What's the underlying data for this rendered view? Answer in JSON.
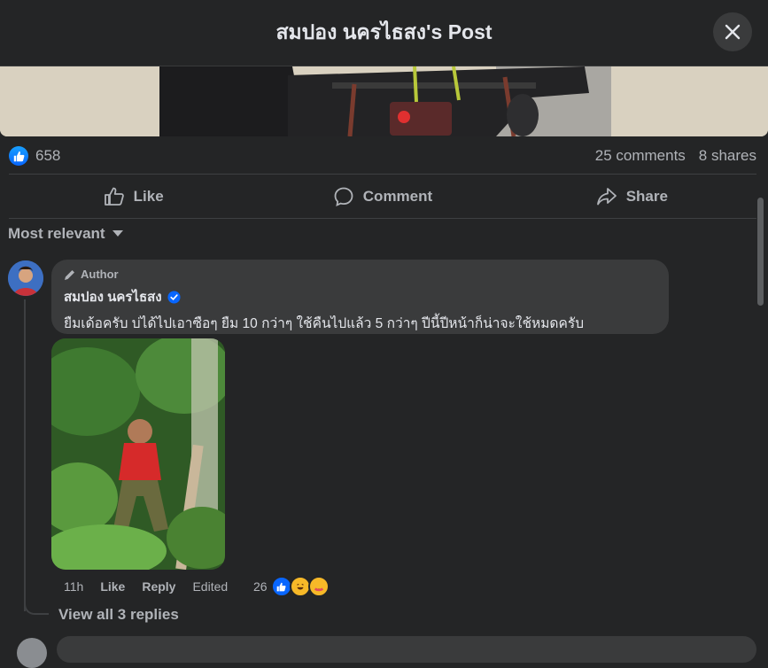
{
  "header": {
    "title": "สมปอง นครไธสง's Post",
    "close_icon": "close-icon"
  },
  "post": {
    "photo_icon": "motorbike-photo",
    "reaction_icon": "like-icon",
    "like_count": "658",
    "comments": "25 comments",
    "shares": "8 shares"
  },
  "actions": {
    "like": "Like",
    "comment": "Comment",
    "share": "Share"
  },
  "sort": {
    "label": "Most relevant"
  },
  "comment": {
    "author_badge": "Author",
    "name": "สมปอง นครไธสง",
    "verified_icon": "verified-badge-icon",
    "text": "ยืมเด้อครับ บ่ได้ไปเอาซือๆ ยืม 10 กว่าๆ ใช้คืนไปแล้ว 5 กว่าๆ ปีนี้ปีหน้าก็น่าจะใช้หมดครับ",
    "time": "11h",
    "like": "Like",
    "reply": "Reply",
    "edited": "Edited",
    "reaction_count": "26",
    "view_replies": "View all 3 replies"
  },
  "colors": {
    "background": "#242526",
    "bubble": "#3a3b3c",
    "accent": "#0866ff",
    "muted": "#b0b3b8"
  }
}
